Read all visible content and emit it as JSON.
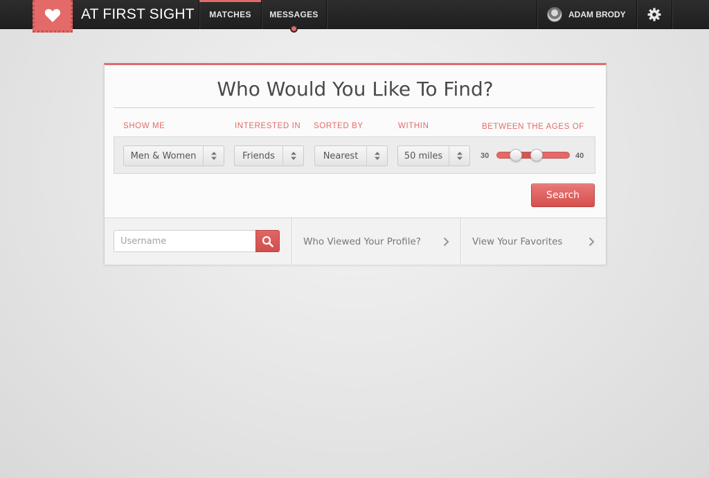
{
  "header": {
    "brand": "AT FIRST SIGHT",
    "nav": [
      {
        "label": "MATCHES",
        "active": true
      },
      {
        "label": "MESSAGES",
        "active": false,
        "has_notification": true
      }
    ],
    "user": {
      "name": "ADAM BRODY"
    },
    "icons": {
      "logo": "heart-icon",
      "settings": "gear-icon"
    }
  },
  "search_card": {
    "title": "Who Would You Like To Find?",
    "filters": [
      {
        "label": "SHOW ME",
        "value": "Men & Women"
      },
      {
        "label": "INTERESTED IN",
        "value": "Friends"
      },
      {
        "label": "SORTED BY",
        "value": "Nearest"
      },
      {
        "label": "WITHIN",
        "value": "50 miles"
      }
    ],
    "age_range": {
      "label": "BETWEEN THE AGES OF",
      "min": "30",
      "max": "40"
    },
    "search_button": "Search"
  },
  "bottom": {
    "username_placeholder": "Username",
    "links": [
      {
        "label": "Who Viewed Your Profile?"
      },
      {
        "label": "View Your Favorites"
      }
    ]
  },
  "colors": {
    "accent": "#e36a68",
    "topbar": "#262626"
  }
}
